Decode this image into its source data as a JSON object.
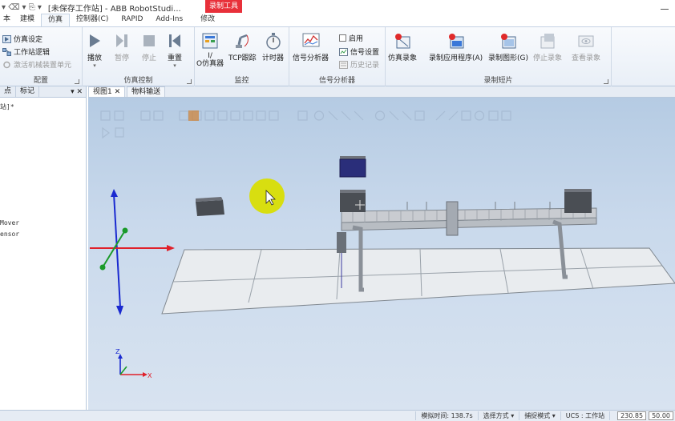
{
  "window": {
    "title": "[未保存工作站] - ABB RobotStudi...",
    "contextual_tab": "录制工具"
  },
  "tabs": [
    {
      "label": "本"
    },
    {
      "label": "建模"
    },
    {
      "label": "仿真"
    },
    {
      "label": "控制器(C)"
    },
    {
      "label": "RAPID"
    },
    {
      "label": "Add-Ins"
    },
    {
      "label": "修改"
    }
  ],
  "ribbon": {
    "config": {
      "label": "配置",
      "sim_setup": "仿真设定",
      "station_logic": "工作站逻辑",
      "activate_unit": "激活机械装置单元"
    },
    "sim_control": {
      "label": "仿真控制",
      "play": "播放",
      "pause": "暂停",
      "stop": "停止",
      "reset": "重置"
    },
    "monitor": {
      "label": "监控",
      "io_sim": "I/\nO仿真器",
      "tcp_trace": "TCP跟踪",
      "timer": "计时器"
    },
    "signal": {
      "label": "信号分析器",
      "analyzer": "信号分析器",
      "enable": "启用",
      "settings": "信号设置",
      "history": "历史记录"
    },
    "record": {
      "label": "录制短片",
      "sim_record": "仿真录象",
      "app_record": "录制应用程序(A)",
      "graphic_record": "录制图形(G)",
      "stop_record": "停止录象",
      "view_record": "查看录象"
    }
  },
  "left_panel": {
    "tab1": "点",
    "tab2": "标记",
    "pin": "▾ ✕",
    "line1": "站]*",
    "line2": "Mover",
    "line3": "ensor"
  },
  "viewport": {
    "tab1": "视图1",
    "tab1_close": "✕",
    "tab2": "物料输送",
    "axis_z": "Z",
    "axis_x": "X"
  },
  "status": {
    "sim_time": "模拟时间: 138.7s",
    "select_mode": "选择方式 ▾",
    "snap_mode": "捕捉模式 ▾",
    "ucs": "UCS : 工作站",
    "x": "230.85",
    "y": "50.00"
  },
  "colors": {
    "accent_red": "#e8303a",
    "highlight_yellow": "#d8de10",
    "axis_red": "#e0202a",
    "axis_blue": "#1a2ad0",
    "axis_green": "#1a9a2a"
  }
}
